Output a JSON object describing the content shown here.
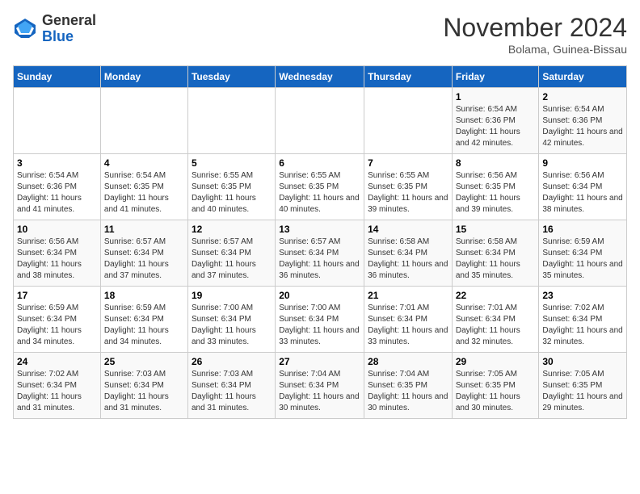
{
  "logo": {
    "general": "General",
    "blue": "Blue"
  },
  "title": "November 2024",
  "subtitle": "Bolama, Guinea-Bissau",
  "days_of_week": [
    "Sunday",
    "Monday",
    "Tuesday",
    "Wednesday",
    "Thursday",
    "Friday",
    "Saturday"
  ],
  "weeks": [
    [
      {
        "day": "",
        "info": ""
      },
      {
        "day": "",
        "info": ""
      },
      {
        "day": "",
        "info": ""
      },
      {
        "day": "",
        "info": ""
      },
      {
        "day": "",
        "info": ""
      },
      {
        "day": "1",
        "info": "Sunrise: 6:54 AM\nSunset: 6:36 PM\nDaylight: 11 hours and 42 minutes."
      },
      {
        "day": "2",
        "info": "Sunrise: 6:54 AM\nSunset: 6:36 PM\nDaylight: 11 hours and 42 minutes."
      }
    ],
    [
      {
        "day": "3",
        "info": "Sunrise: 6:54 AM\nSunset: 6:36 PM\nDaylight: 11 hours and 41 minutes."
      },
      {
        "day": "4",
        "info": "Sunrise: 6:54 AM\nSunset: 6:35 PM\nDaylight: 11 hours and 41 minutes."
      },
      {
        "day": "5",
        "info": "Sunrise: 6:55 AM\nSunset: 6:35 PM\nDaylight: 11 hours and 40 minutes."
      },
      {
        "day": "6",
        "info": "Sunrise: 6:55 AM\nSunset: 6:35 PM\nDaylight: 11 hours and 40 minutes."
      },
      {
        "day": "7",
        "info": "Sunrise: 6:55 AM\nSunset: 6:35 PM\nDaylight: 11 hours and 39 minutes."
      },
      {
        "day": "8",
        "info": "Sunrise: 6:56 AM\nSunset: 6:35 PM\nDaylight: 11 hours and 39 minutes."
      },
      {
        "day": "9",
        "info": "Sunrise: 6:56 AM\nSunset: 6:34 PM\nDaylight: 11 hours and 38 minutes."
      }
    ],
    [
      {
        "day": "10",
        "info": "Sunrise: 6:56 AM\nSunset: 6:34 PM\nDaylight: 11 hours and 38 minutes."
      },
      {
        "day": "11",
        "info": "Sunrise: 6:57 AM\nSunset: 6:34 PM\nDaylight: 11 hours and 37 minutes."
      },
      {
        "day": "12",
        "info": "Sunrise: 6:57 AM\nSunset: 6:34 PM\nDaylight: 11 hours and 37 minutes."
      },
      {
        "day": "13",
        "info": "Sunrise: 6:57 AM\nSunset: 6:34 PM\nDaylight: 11 hours and 36 minutes."
      },
      {
        "day": "14",
        "info": "Sunrise: 6:58 AM\nSunset: 6:34 PM\nDaylight: 11 hours and 36 minutes."
      },
      {
        "day": "15",
        "info": "Sunrise: 6:58 AM\nSunset: 6:34 PM\nDaylight: 11 hours and 35 minutes."
      },
      {
        "day": "16",
        "info": "Sunrise: 6:59 AM\nSunset: 6:34 PM\nDaylight: 11 hours and 35 minutes."
      }
    ],
    [
      {
        "day": "17",
        "info": "Sunrise: 6:59 AM\nSunset: 6:34 PM\nDaylight: 11 hours and 34 minutes."
      },
      {
        "day": "18",
        "info": "Sunrise: 6:59 AM\nSunset: 6:34 PM\nDaylight: 11 hours and 34 minutes."
      },
      {
        "day": "19",
        "info": "Sunrise: 7:00 AM\nSunset: 6:34 PM\nDaylight: 11 hours and 33 minutes."
      },
      {
        "day": "20",
        "info": "Sunrise: 7:00 AM\nSunset: 6:34 PM\nDaylight: 11 hours and 33 minutes."
      },
      {
        "day": "21",
        "info": "Sunrise: 7:01 AM\nSunset: 6:34 PM\nDaylight: 11 hours and 33 minutes."
      },
      {
        "day": "22",
        "info": "Sunrise: 7:01 AM\nSunset: 6:34 PM\nDaylight: 11 hours and 32 minutes."
      },
      {
        "day": "23",
        "info": "Sunrise: 7:02 AM\nSunset: 6:34 PM\nDaylight: 11 hours and 32 minutes."
      }
    ],
    [
      {
        "day": "24",
        "info": "Sunrise: 7:02 AM\nSunset: 6:34 PM\nDaylight: 11 hours and 31 minutes."
      },
      {
        "day": "25",
        "info": "Sunrise: 7:03 AM\nSunset: 6:34 PM\nDaylight: 11 hours and 31 minutes."
      },
      {
        "day": "26",
        "info": "Sunrise: 7:03 AM\nSunset: 6:34 PM\nDaylight: 11 hours and 31 minutes."
      },
      {
        "day": "27",
        "info": "Sunrise: 7:04 AM\nSunset: 6:34 PM\nDaylight: 11 hours and 30 minutes."
      },
      {
        "day": "28",
        "info": "Sunrise: 7:04 AM\nSunset: 6:35 PM\nDaylight: 11 hours and 30 minutes."
      },
      {
        "day": "29",
        "info": "Sunrise: 7:05 AM\nSunset: 6:35 PM\nDaylight: 11 hours and 30 minutes."
      },
      {
        "day": "30",
        "info": "Sunrise: 7:05 AM\nSunset: 6:35 PM\nDaylight: 11 hours and 29 minutes."
      }
    ]
  ]
}
